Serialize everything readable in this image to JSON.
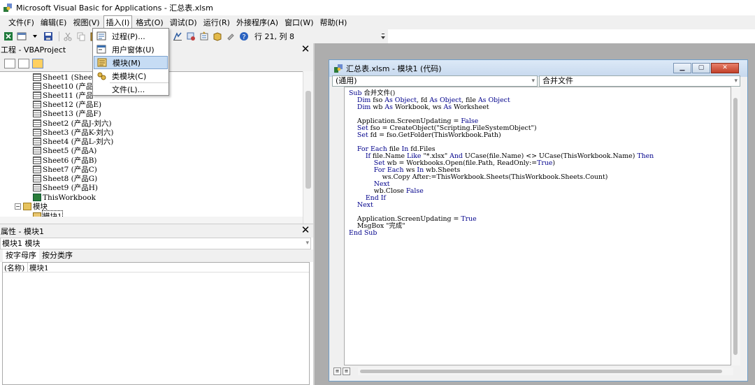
{
  "window": {
    "title": "Microsoft Visual Basic for Applications - 汇总表.xlsm"
  },
  "menubar": {
    "items": [
      "文件(F)",
      "编辑(E)",
      "视图(V)",
      "插入(I)",
      "格式(O)",
      "调试(D)",
      "运行(R)",
      "外接程序(A)",
      "窗口(W)",
      "帮助(H)"
    ],
    "open_index": 3
  },
  "toolbar": {
    "position": "行 21, 列 8"
  },
  "insert_menu": {
    "items": [
      {
        "label": "过程(P)...",
        "icon": "procedure-icon"
      },
      {
        "label": "用户窗体(U)",
        "icon": "userform-icon"
      },
      {
        "label": "模块(M)",
        "icon": "module-icon",
        "highlighted": true
      },
      {
        "label": "类模块(C)",
        "icon": "class-module-icon"
      },
      {
        "label": "文件(L)...",
        "icon": ""
      }
    ]
  },
  "project": {
    "header": "工程 - VBAProject",
    "tree": [
      "Sheet1 (Sheet",
      "Sheet10 (产品",
      "Sheet11 (产品",
      "Sheet12 (产品E)",
      "Sheet13 (产品F)",
      "Sheet2 (产品J-刘六)",
      "Sheet3 (产品K-刘六)",
      "Sheet4 (产品L-刘六)",
      "Sheet5 (产品A)",
      "Sheet6 (产品B)",
      "Sheet7 (产品C)",
      "Sheet8 (产品G)",
      "Sheet9 (产品H)",
      "ThisWorkbook"
    ],
    "modules_folder": "模块",
    "module_item": "模块1"
  },
  "properties": {
    "header": "属性 - 模块1",
    "object_combo": "模块1 模块",
    "tabs": [
      "按字母序",
      "按分类序"
    ],
    "rows": [
      {
        "name": "(名称)",
        "value": "模块1"
      }
    ]
  },
  "code_window": {
    "title": "汇总表.xlsm - 模块1 (代码)",
    "object_combo": "(通用)",
    "proc_combo": "合并文件",
    "lines": [
      "Sub 合并文件()",
      "    Dim fso As Object, fd As Object, file As Object",
      "    Dim wb As Workbook, ws As Worksheet",
      "",
      "    Application.ScreenUpdating = False",
      "    Set fso = CreateObject(\"Scripting.FileSystemObject\")",
      "    Set fd = fso.GetFolder(ThisWorkbook.Path)",
      "",
      "    For Each file In fd.Files",
      "        If file.Name Like \"*.xlsx\" And UCase(file.Name) <> UCase(ThisWorkbook.Name) Then",
      "            Set wb = Workbooks.Open(file.Path, ReadOnly:=True)",
      "            For Each ws In wb.Sheets",
      "                ws.Copy After:=ThisWorkbook.Sheets(ThisWorkbook.Sheets.Count)",
      "            Next",
      "            wb.Close False",
      "        End If",
      "    Next",
      "",
      "    Application.ScreenUpdating = True",
      "    MsgBox \"完成\"",
      "End Sub"
    ]
  },
  "colors": {
    "keyword": "#00008b",
    "menu_highlight": "#c6dcf4",
    "mdi_background": "#adadad"
  }
}
